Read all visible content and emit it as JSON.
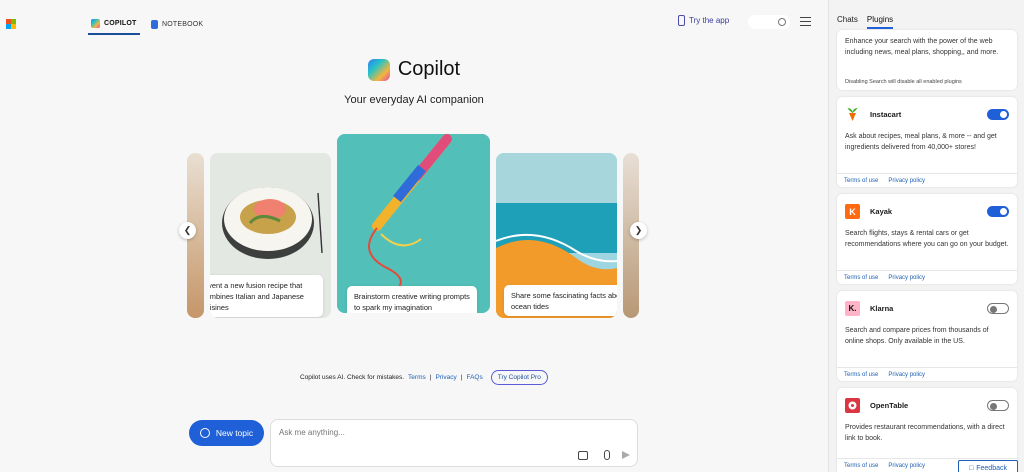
{
  "topbar": {
    "tabs": [
      {
        "label": "COPILOT",
        "active": true
      },
      {
        "label": "NOTEBOOK",
        "active": false
      }
    ],
    "try_app": "Try the app"
  },
  "hero": {
    "title": "Copilot",
    "subtitle": "Your everyday AI companion"
  },
  "carousel": {
    "cards": [
      {
        "caption": "Invent a new fusion recipe that combines Italian and Japanese cuisines"
      },
      {
        "caption": "Brainstorm creative writing prompts to spark my imagination"
      },
      {
        "caption": "Share some fascinating facts about ocean tides"
      }
    ]
  },
  "disclaimer": {
    "text": "Copilot uses AI. Check for mistakes.",
    "terms": "Terms",
    "privacy": "Privacy",
    "faqs": "FAQs",
    "pro": "Try Copilot Pro"
  },
  "composer": {
    "new_topic": "New topic",
    "placeholder": "Ask me anything..."
  },
  "sidebar": {
    "tabs": [
      {
        "label": "Chats",
        "active": false
      },
      {
        "label": "Plugins",
        "active": true
      }
    ],
    "search_card": {
      "desc": "Enhance your search with the power of the web including news, meal plans, shopping,, and more.",
      "note": "Disabling Search will disable all enabled plugins"
    },
    "plugins": [
      {
        "name": "Instacart",
        "desc": "Ask about recipes, meal plans, & more -- and get ingredients delivered from 40,000+ stores!",
        "enabled": true,
        "terms": "Terms of use",
        "privacy": "Privacy policy",
        "logo_color": "#ffffff"
      },
      {
        "name": "Kayak",
        "desc": "Search flights, stays & rental cars or get recommendations where you can go on your budget.",
        "enabled": true,
        "terms": "Terms of use",
        "privacy": "Privacy policy",
        "logo_color": "#ff690f",
        "logo_letter": "K"
      },
      {
        "name": "Klarna",
        "desc": "Search and compare prices from thousands of online shops. Only available in the US.",
        "enabled": false,
        "terms": "Terms of use",
        "privacy": "Privacy policy",
        "logo_color": "#ffb3c7",
        "logo_letter": "K."
      },
      {
        "name": "OpenTable",
        "desc": "Provides restaurant recommendations, with a direct link to book.",
        "enabled": false,
        "terms": "Terms of use",
        "privacy": "Privacy policy",
        "logo_color": "#da3743"
      }
    ]
  },
  "feedback": "Feedback",
  "colors": {
    "accent": "#1f5fd8",
    "link": "#1f5fb5"
  }
}
